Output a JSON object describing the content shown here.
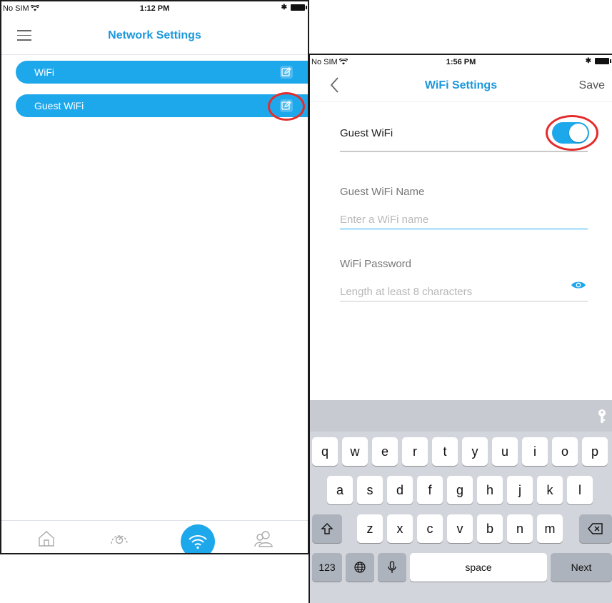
{
  "screen1": {
    "status": {
      "carrier": "No SIM",
      "time": "1:12 PM"
    },
    "title": "Network Settings",
    "items": [
      {
        "label": "WiFi"
      },
      {
        "label": "Guest WiFi"
      }
    ],
    "tabs": [
      "home-icon",
      "speedometer-icon",
      "wifi-icon",
      "users-icon"
    ]
  },
  "screen2": {
    "status": {
      "carrier": "No SIM",
      "time": "1:56 PM"
    },
    "title": "WiFi Settings",
    "save_label": "Save",
    "guest_toggle": {
      "label": "Guest WiFi",
      "on": true
    },
    "name_field": {
      "label": "Guest WiFi Name",
      "placeholder": "Enter a WiFi name",
      "value": ""
    },
    "password_field": {
      "label": "WiFi Password",
      "placeholder": "Length at least 8 characters",
      "value": ""
    },
    "keyboard": {
      "row1": [
        "q",
        "w",
        "e",
        "r",
        "t",
        "y",
        "u",
        "i",
        "o",
        "p"
      ],
      "row2": [
        "a",
        "s",
        "d",
        "f",
        "g",
        "h",
        "j",
        "k",
        "l"
      ],
      "row3": [
        "z",
        "x",
        "c",
        "v",
        "b",
        "n",
        "m"
      ],
      "numbers_key": "123",
      "space_key": "space",
      "return_key": "Next"
    }
  },
  "colors": {
    "accent": "#1ea8ec",
    "title": "#1c98dc",
    "callout": "#e32d2d"
  }
}
